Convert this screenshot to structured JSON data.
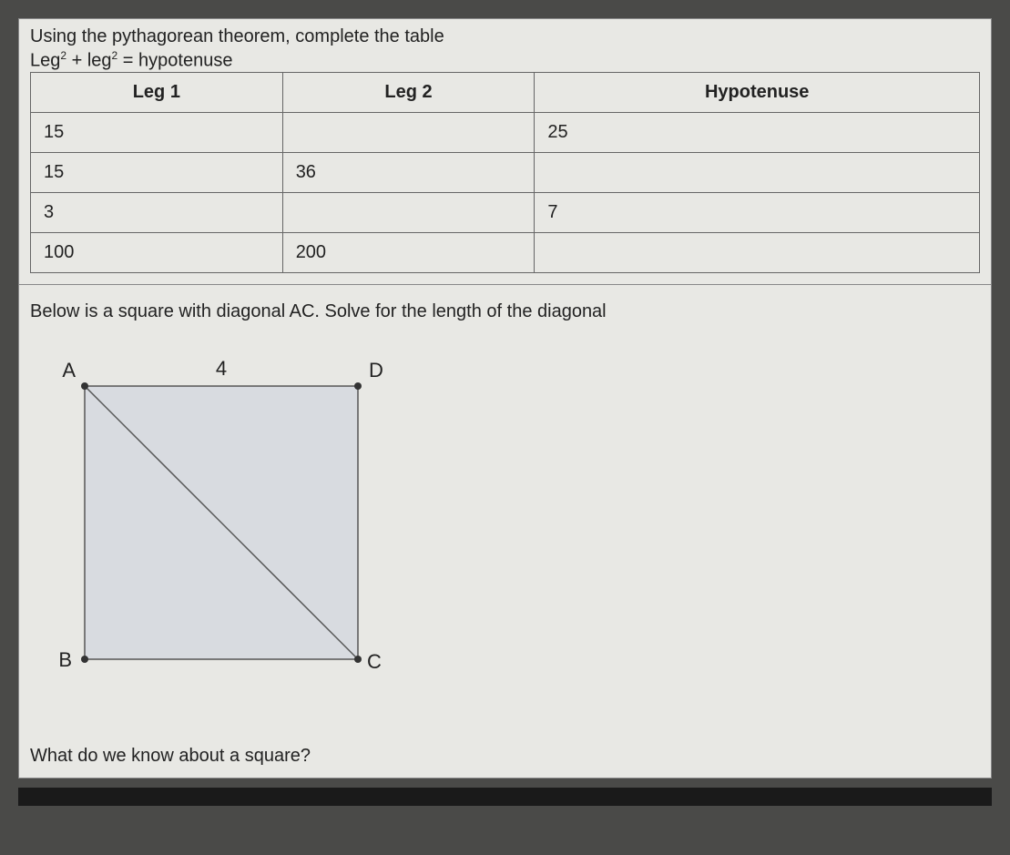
{
  "section1": {
    "intro1": "Using the pythagorean theorem, complete the table",
    "intro2_prefix": "Leg",
    "intro2_plus": " + leg",
    "intro2_eq": " = hypotenuse",
    "headers": {
      "col1": "Leg 1",
      "col2": "Leg 2",
      "col3": "Hypotenuse"
    },
    "rows": [
      {
        "leg1": "15",
        "leg2": "",
        "hyp": "25"
      },
      {
        "leg1": "15",
        "leg2": "36",
        "hyp": ""
      },
      {
        "leg1": "3",
        "leg2": "",
        "hyp": "7"
      },
      {
        "leg1": "100",
        "leg2": "200",
        "hyp": ""
      }
    ]
  },
  "section2": {
    "problem": "Below is a square with diagonal AC. Solve for the length of the diagonal",
    "labels": {
      "A": "A",
      "B": "B",
      "C": "C",
      "D": "D",
      "side": "4"
    },
    "question": "What do we know about a square?"
  }
}
